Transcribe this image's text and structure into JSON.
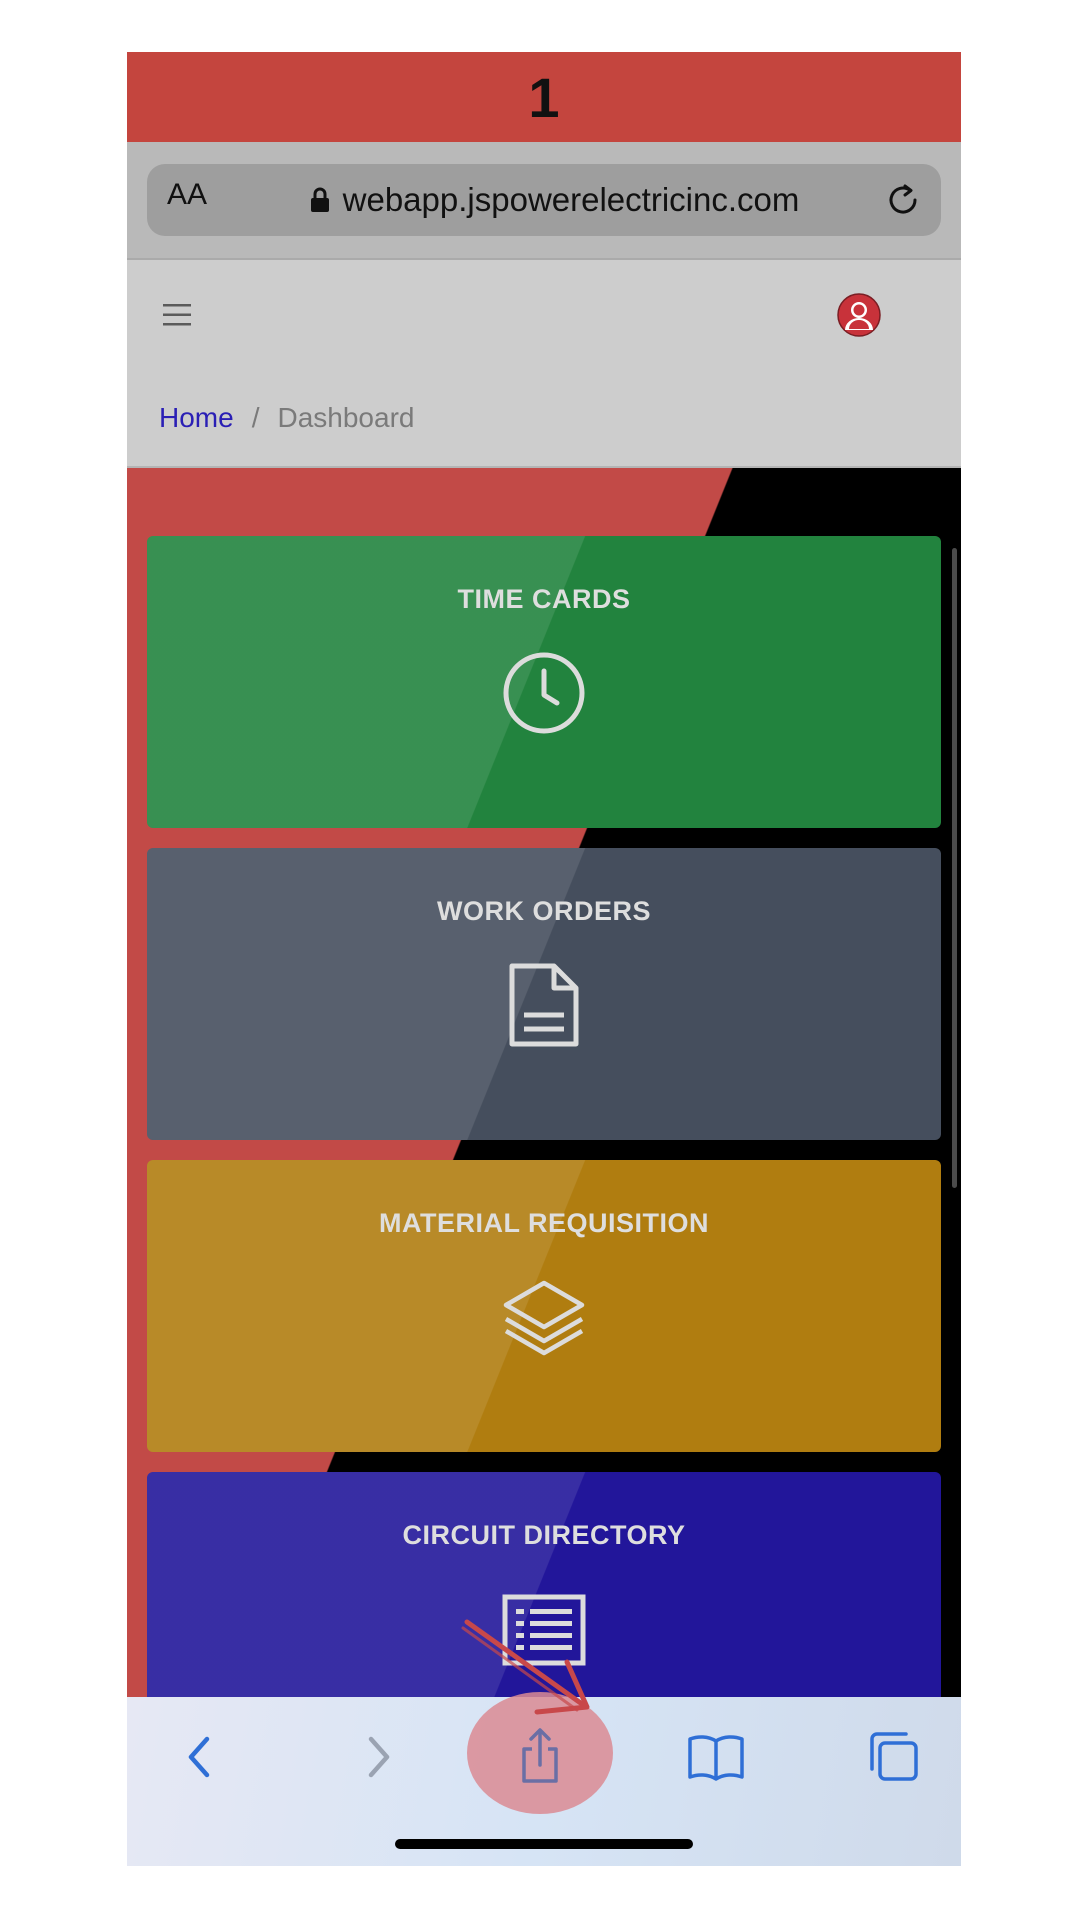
{
  "step_banner": {
    "number": "1"
  },
  "address_bar": {
    "text_size_label": "AA",
    "url": "webapp.jspowerelectricinc.com",
    "lock_icon": "lock-icon",
    "reload_icon": "reload-icon"
  },
  "header": {
    "menu_icon": "hamburger-icon",
    "profile_icon": "user-avatar-icon"
  },
  "breadcrumb": {
    "home": "Home",
    "separator": "/",
    "current": "Dashboard"
  },
  "cards": [
    {
      "title": "TIME CARDS",
      "icon": "clock-icon",
      "color": "#22833e"
    },
    {
      "title": "WORK ORDERS",
      "icon": "document-icon",
      "color": "#454e5d"
    },
    {
      "title": "MATERIAL REQUISITION",
      "icon": "layers-icon",
      "color": "#b07d10"
    },
    {
      "title": "CIRCUIT DIRECTORY",
      "icon": "list-table-icon",
      "color": "#22169a"
    }
  ],
  "toolbar": {
    "back_icon": "chevron-left-icon",
    "forward_icon": "chevron-right-icon",
    "share_icon": "share-icon",
    "bookmarks_icon": "book-icon",
    "tabs_icon": "tabs-icon",
    "highlight_color": "#db8b93"
  },
  "colors": {
    "banner": "#c4453e",
    "link": "#2a1fb5",
    "toolbar_icon": "#2f6fd6"
  }
}
